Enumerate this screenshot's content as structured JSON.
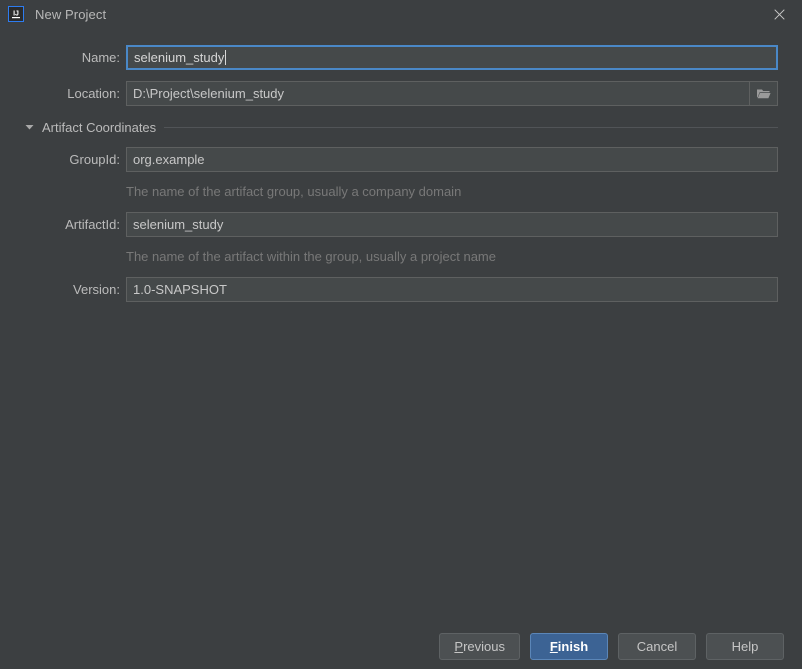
{
  "window": {
    "title": "New Project",
    "app_icon": "intellij-idea-icon",
    "close_icon": "close-icon",
    "background": "#3c3f41",
    "accent": "#4a88c7",
    "primary_button_color": "#3c6394"
  },
  "form": {
    "name": {
      "label": "Name:",
      "value": "selenium_study",
      "placeholder": "",
      "focused": true
    },
    "location": {
      "label": "Location:",
      "value": "D:\\Project\\selenium_study",
      "placeholder": "",
      "browse_icon": "folder-icon"
    }
  },
  "section": {
    "title": "Artifact Coordinates",
    "expanded": true,
    "twisty_icon": "chevron-down-icon",
    "fields": {
      "groupid": {
        "label": "GroupId:",
        "value": "org.example",
        "hint": "The name of the artifact group, usually a company domain"
      },
      "artifactid": {
        "label": "ArtifactId:",
        "value": "selenium_study",
        "hint": "The name of the artifact within the group, usually a project name"
      },
      "version": {
        "label": "Version:",
        "value": "1.0-SNAPSHOT",
        "hint": ""
      }
    }
  },
  "footer": {
    "previous": {
      "prefix": "",
      "mnemonic": "P",
      "suffix": "revious"
    },
    "finish": {
      "prefix": "",
      "mnemonic": "F",
      "suffix": "inish"
    },
    "cancel": "Cancel",
    "help": "Help"
  }
}
